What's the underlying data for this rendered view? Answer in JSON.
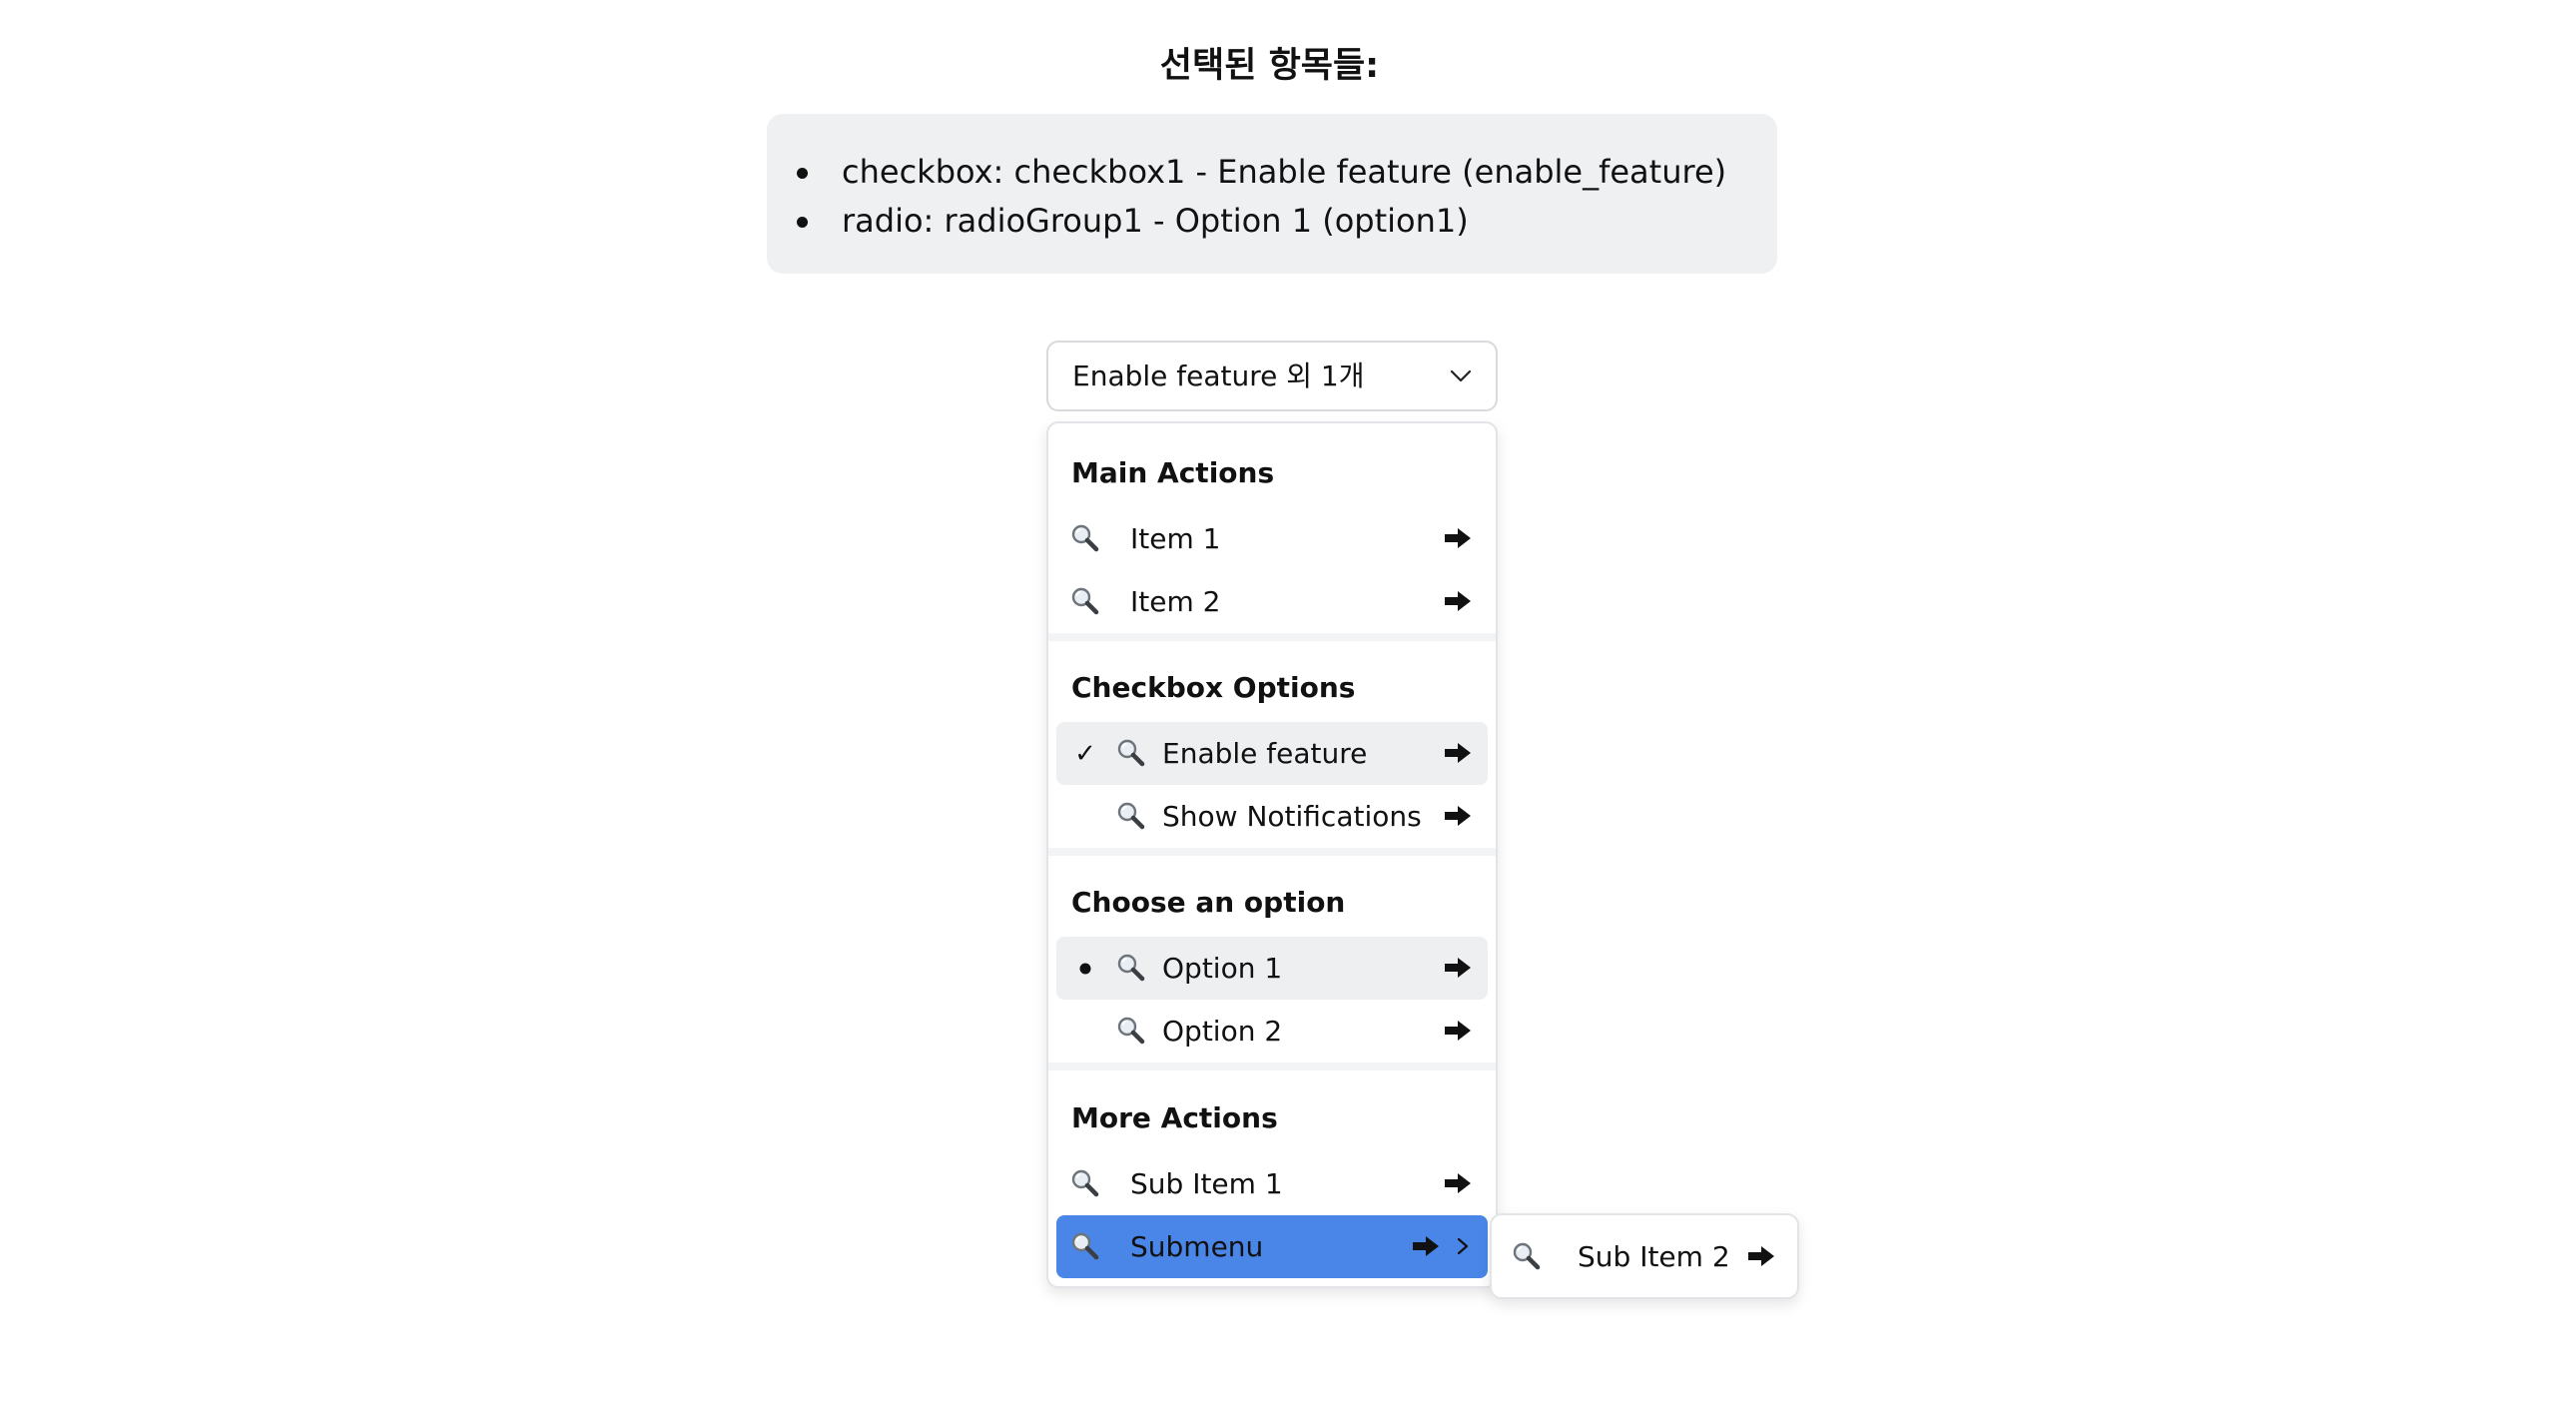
{
  "heading": "선택된 항목들:",
  "selected": [
    "checkbox: checkbox1 - Enable feature (enable_feature)",
    "radio: radioGroup1 - Option 1 (option1)"
  ],
  "trigger": {
    "label": "Enable feature 외 1개"
  },
  "menu": {
    "groups": [
      {
        "label": "Main Actions",
        "items": [
          {
            "label": "Item 1"
          },
          {
            "label": "Item 2"
          }
        ]
      },
      {
        "label": "Checkbox Options",
        "items": [
          {
            "label": "Enable feature",
            "checked": true
          },
          {
            "label": "Show Notifications",
            "checked": false
          }
        ]
      },
      {
        "label": "Choose an option",
        "items": [
          {
            "label": "Option 1",
            "selected": true
          },
          {
            "label": "Option 2",
            "selected": false
          }
        ]
      },
      {
        "label": "More Actions",
        "items": [
          {
            "label": "Sub Item 1"
          },
          {
            "label": "Submenu",
            "has_submenu": true,
            "highlighted": true
          }
        ]
      }
    ],
    "check_glyph": "✓"
  },
  "submenu": {
    "items": [
      {
        "label": "Sub Item 2"
      }
    ]
  },
  "colors": {
    "highlight": "#4a86e8",
    "selected_bg": "#eeeff1",
    "summary_bg": "#eff0f2"
  }
}
